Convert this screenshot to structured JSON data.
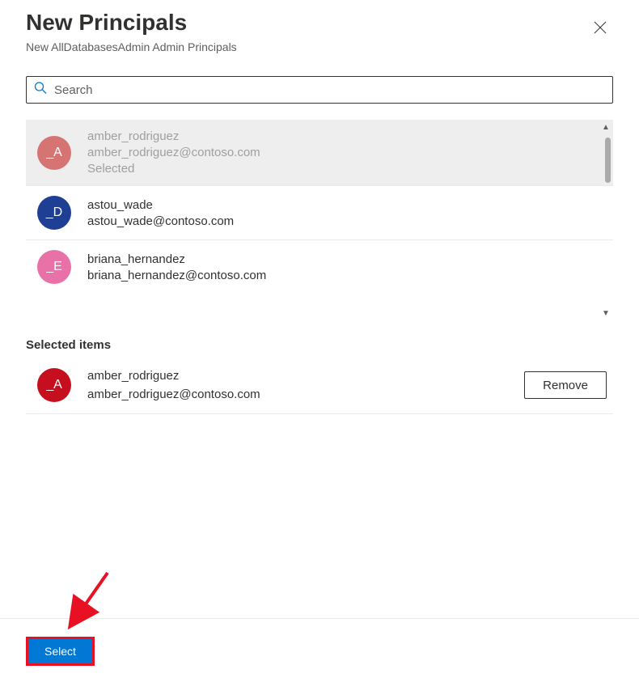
{
  "header": {
    "title": "New Principals",
    "subtitle": "New AllDatabasesAdmin Admin Principals"
  },
  "search": {
    "placeholder": "Search"
  },
  "results": [
    {
      "avatar_text": "_A",
      "avatar_color": "#d67373",
      "name": "amber_rodriguez",
      "email": "amber_rodriguez@contoso.com",
      "status": "Selected",
      "selected": true
    },
    {
      "avatar_text": "_D",
      "avatar_color": "#1f3f94",
      "name": "astou_wade",
      "email": "astou_wade@contoso.com",
      "status": "",
      "selected": false
    },
    {
      "avatar_text": "_E",
      "avatar_color": "#e871a8",
      "name": "briana_hernandez",
      "email": "briana_hernandez@contoso.com",
      "status": "",
      "selected": false
    }
  ],
  "selected_section": {
    "label": "Selected items",
    "items": [
      {
        "avatar_text": "_A",
        "avatar_color": "#c50f1f",
        "name": "amber_rodriguez",
        "email": "amber_rodriguez@contoso.com"
      }
    ],
    "remove_label": "Remove"
  },
  "footer": {
    "select_label": "Select"
  }
}
